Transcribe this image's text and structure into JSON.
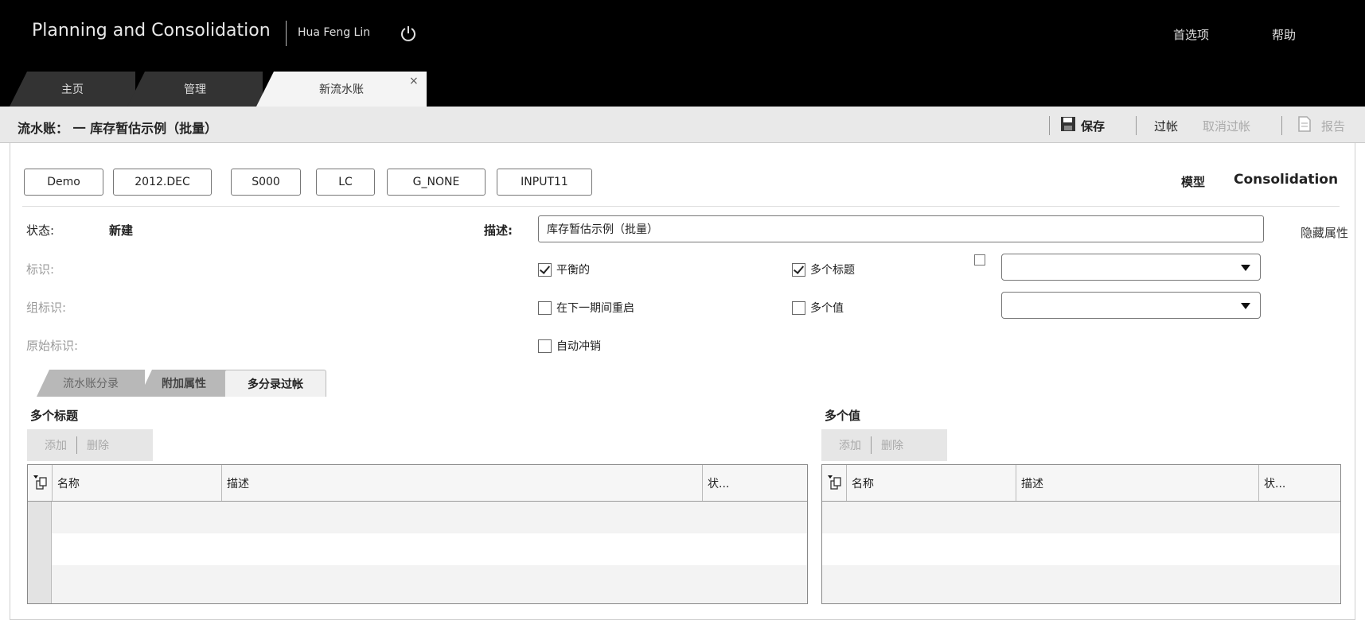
{
  "header": {
    "app_title": "Planning and Consolidation",
    "user": "Hua Feng Lin",
    "options": "首选项",
    "help": "帮助"
  },
  "tabs": [
    {
      "label": "主页"
    },
    {
      "label": "管理"
    },
    {
      "label": "新流水账",
      "close": "×"
    }
  ],
  "titlebar": {
    "title": "流水账： 一 库存暂估示例（批量）",
    "save": "保存",
    "post": "过帐",
    "unpost": "取消过帐",
    "report": "报告"
  },
  "dimensions": [
    "Demo",
    "2012.DEC",
    "S000",
    "LC",
    "G_NONE",
    "INPUT11"
  ],
  "model": {
    "label": "模型",
    "value": "Consolidation"
  },
  "form": {
    "status_label": "状态:",
    "status_value": "新建",
    "id_label": "标识:",
    "group_id_label": "组标识:",
    "original_id_label": "原始标识:",
    "desc_label": "描述:",
    "desc_value": "库存暂估示例（批量）",
    "hide_attributes": "隐藏属性",
    "balanced": {
      "label": "平衡的",
      "checked": true
    },
    "multi_heading": {
      "label": "多个标题",
      "checked": true
    },
    "restart_next_period": {
      "label": "在下一期间重启",
      "checked": false
    },
    "multi_value": {
      "label": "多个值",
      "checked": false
    },
    "auto_reverse": {
      "label": "自动冲销",
      "checked": false
    }
  },
  "subtabs": [
    "流水账分录",
    "附加属性",
    "多分录过帐"
  ],
  "left_panel": {
    "title": "多个标题",
    "add": "添加",
    "delete": "删除",
    "columns": [
      "名称",
      "描述",
      "状..."
    ]
  },
  "right_panel": {
    "title": "多个值",
    "add": "添加",
    "delete": "删除",
    "columns": [
      "名称",
      "描述",
      "状..."
    ]
  }
}
